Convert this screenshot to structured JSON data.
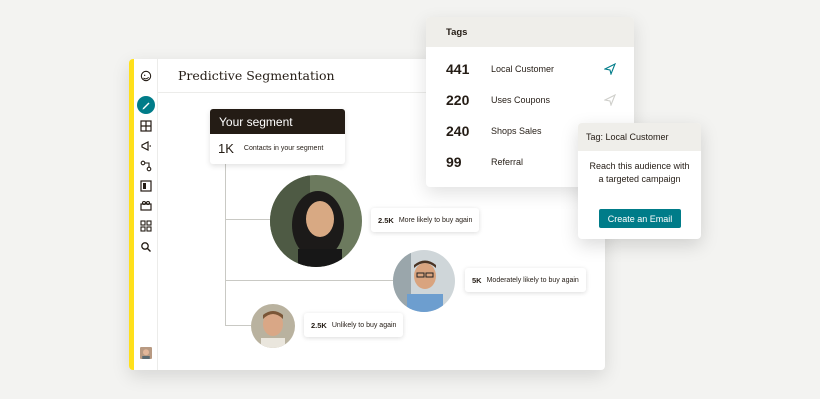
{
  "app": {
    "title": "Predictive Segmentation",
    "colors": {
      "accent": "#ffe01b",
      "brand": "#007c89",
      "dark": "#241c15"
    },
    "sidebar": {
      "icons": [
        "mailchimp-logo",
        "pencil-icon",
        "audience-icon",
        "megaphone-icon",
        "automation-icon",
        "website-icon",
        "integrations-icon",
        "grid-icon",
        "search-icon"
      ]
    }
  },
  "segment": {
    "title": "Your segment",
    "count": "1K",
    "label": "Contacts in your segment"
  },
  "predictions": [
    {
      "value": "2.5K",
      "label": "More likely to buy again"
    },
    {
      "value": "5K",
      "label": "Moderately likely to buy again"
    },
    {
      "value": "2.5K",
      "label": "Unlikely to buy again"
    }
  ],
  "tags": {
    "title": "Tags",
    "rows": [
      {
        "count": "441",
        "name": "Local Customer"
      },
      {
        "count": "220",
        "name": "Uses Coupons"
      },
      {
        "count": "240",
        "name": "Shops Sales"
      },
      {
        "count": "99",
        "name": "Referral"
      }
    ]
  },
  "popover": {
    "title": "Tag: Local Customer",
    "text": "Reach this audience with a targeted campaign",
    "button": "Create an Email"
  }
}
